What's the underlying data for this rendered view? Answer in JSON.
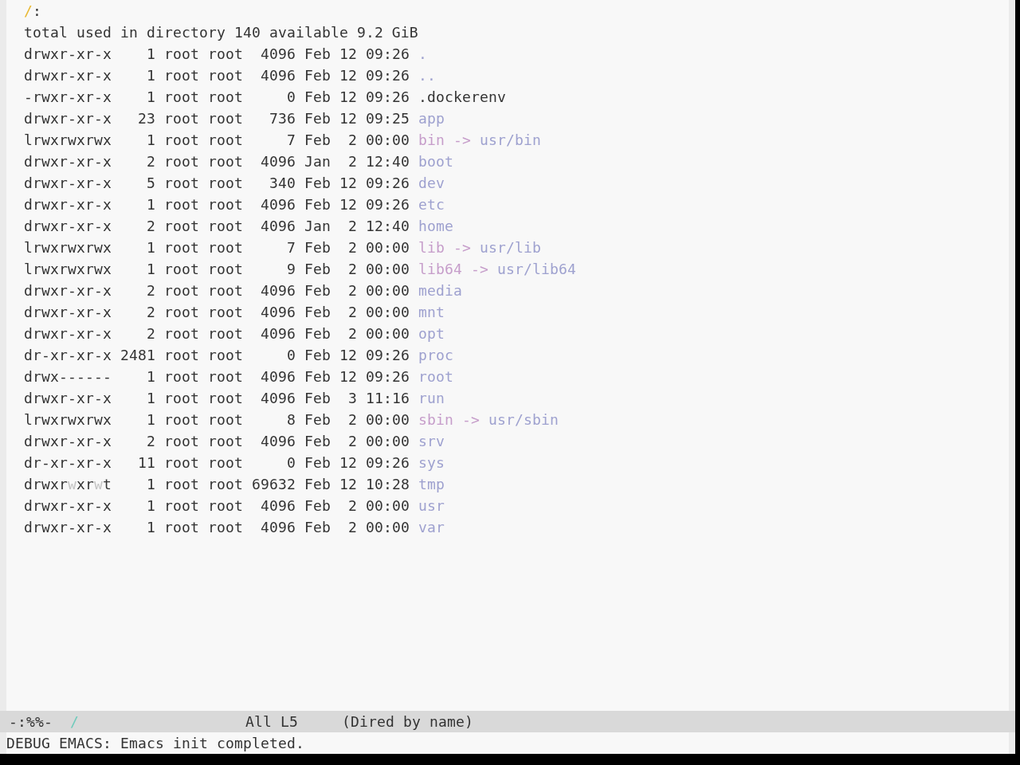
{
  "header": {
    "path": "/",
    "suffix": ":"
  },
  "summary": "total used in directory 140 available 9.2 GiB",
  "entries": [
    {
      "permissions": "drwxr-xr-x",
      "links": "1",
      "owner": "root",
      "group": "root",
      "size": "4096",
      "date": "Feb 12 09:26",
      "kind": "directory",
      "name": "."
    },
    {
      "permissions": "drwxr-xr-x",
      "links": "1",
      "owner": "root",
      "group": "root",
      "size": "4096",
      "date": "Feb 12 09:26",
      "kind": "directory",
      "name": ".."
    },
    {
      "permissions": "-rwxr-xr-x",
      "links": "1",
      "owner": "root",
      "group": "root",
      "size": "0",
      "date": "Feb 12 09:26",
      "kind": "file",
      "name": ".dockerenv"
    },
    {
      "permissions": "drwxr-xr-x",
      "links": "23",
      "owner": "root",
      "group": "root",
      "size": "736",
      "date": "Feb 12 09:25",
      "kind": "directory",
      "name": "app"
    },
    {
      "permissions": "lrwxrwxrwx",
      "links": "1",
      "owner": "root",
      "group": "root",
      "size": "7",
      "date": "Feb  2 00:00",
      "kind": "symlink",
      "name": "bin",
      "arrow": "->",
      "target": "usr/bin"
    },
    {
      "permissions": "drwxr-xr-x",
      "links": "2",
      "owner": "root",
      "group": "root",
      "size": "4096",
      "date": "Jan  2 12:40",
      "kind": "directory",
      "name": "boot"
    },
    {
      "permissions": "drwxr-xr-x",
      "links": "5",
      "owner": "root",
      "group": "root",
      "size": "340",
      "date": "Feb 12 09:26",
      "kind": "directory",
      "name": "dev"
    },
    {
      "permissions": "drwxr-xr-x",
      "links": "1",
      "owner": "root",
      "group": "root",
      "size": "4096",
      "date": "Feb 12 09:26",
      "kind": "directory",
      "name": "etc"
    },
    {
      "permissions": "drwxr-xr-x",
      "links": "2",
      "owner": "root",
      "group": "root",
      "size": "4096",
      "date": "Jan  2 12:40",
      "kind": "directory",
      "name": "home"
    },
    {
      "permissions": "lrwxrwxrwx",
      "links": "1",
      "owner": "root",
      "group": "root",
      "size": "7",
      "date": "Feb  2 00:00",
      "kind": "symlink",
      "name": "lib",
      "arrow": "->",
      "target": "usr/lib"
    },
    {
      "permissions": "lrwxrwxrwx",
      "links": "1",
      "owner": "root",
      "group": "root",
      "size": "9",
      "date": "Feb  2 00:00",
      "kind": "symlink",
      "name": "lib64",
      "arrow": "->",
      "target": "usr/lib64"
    },
    {
      "permissions": "drwxr-xr-x",
      "links": "2",
      "owner": "root",
      "group": "root",
      "size": "4096",
      "date": "Feb  2 00:00",
      "kind": "directory",
      "name": "media"
    },
    {
      "permissions": "drwxr-xr-x",
      "links": "2",
      "owner": "root",
      "group": "root",
      "size": "4096",
      "date": "Feb  2 00:00",
      "kind": "directory",
      "name": "mnt"
    },
    {
      "permissions": "drwxr-xr-x",
      "links": "2",
      "owner": "root",
      "group": "root",
      "size": "4096",
      "date": "Feb  2 00:00",
      "kind": "directory",
      "name": "opt"
    },
    {
      "permissions": "dr-xr-xr-x",
      "links": "2481",
      "owner": "root",
      "group": "root",
      "size": "0",
      "date": "Feb 12 09:26",
      "kind": "directory",
      "name": "proc"
    },
    {
      "permissions": "drwx------",
      "links": "1",
      "owner": "root",
      "group": "root",
      "size": "4096",
      "date": "Feb 12 09:26",
      "kind": "directory",
      "name": "root"
    },
    {
      "permissions": "drwxr-xr-x",
      "links": "1",
      "owner": "root",
      "group": "root",
      "size": "4096",
      "date": "Feb  3 11:16",
      "kind": "directory",
      "name": "run"
    },
    {
      "permissions": "lrwxrwxrwx",
      "links": "1",
      "owner": "root",
      "group": "root",
      "size": "8",
      "date": "Feb  2 00:00",
      "kind": "symlink",
      "name": "sbin",
      "arrow": "->",
      "target": "usr/sbin"
    },
    {
      "permissions": "drwxr-xr-x",
      "links": "2",
      "owner": "root",
      "group": "root",
      "size": "4096",
      "date": "Feb  2 00:00",
      "kind": "directory",
      "name": "srv"
    },
    {
      "permissions": "dr-xr-xr-x",
      "links": "11",
      "owner": "root",
      "group": "root",
      "size": "0",
      "date": "Feb 12 09:26",
      "kind": "directory",
      "name": "sys"
    },
    {
      "permissions": [
        {
          "text": "drwxr",
          "faded": false
        },
        {
          "text": "w",
          "faded": true
        },
        {
          "text": "xr",
          "faded": false
        },
        {
          "text": "w",
          "faded": true
        },
        {
          "text": "t",
          "faded": false
        }
      ],
      "links": "1",
      "owner": "root",
      "group": "root",
      "size": "69632",
      "date": "Feb 12 10:28",
      "kind": "directory",
      "name": "tmp"
    },
    {
      "permissions": "drwxr-xr-x",
      "links": "1",
      "owner": "root",
      "group": "root",
      "size": "4096",
      "date": "Feb  2 00:00",
      "kind": "directory",
      "name": "usr"
    },
    {
      "permissions": "drwxr-xr-x",
      "links": "1",
      "owner": "root",
      "group": "root",
      "size": "4096",
      "date": "Feb  2 00:00",
      "kind": "directory",
      "name": "var"
    }
  ],
  "mode_line": {
    "status": "-:%%-",
    "buffer": "/",
    "position": "All L5",
    "mode": "(Dired by name)"
  },
  "echo_area": "DEBUG EMACS: Emacs init completed."
}
